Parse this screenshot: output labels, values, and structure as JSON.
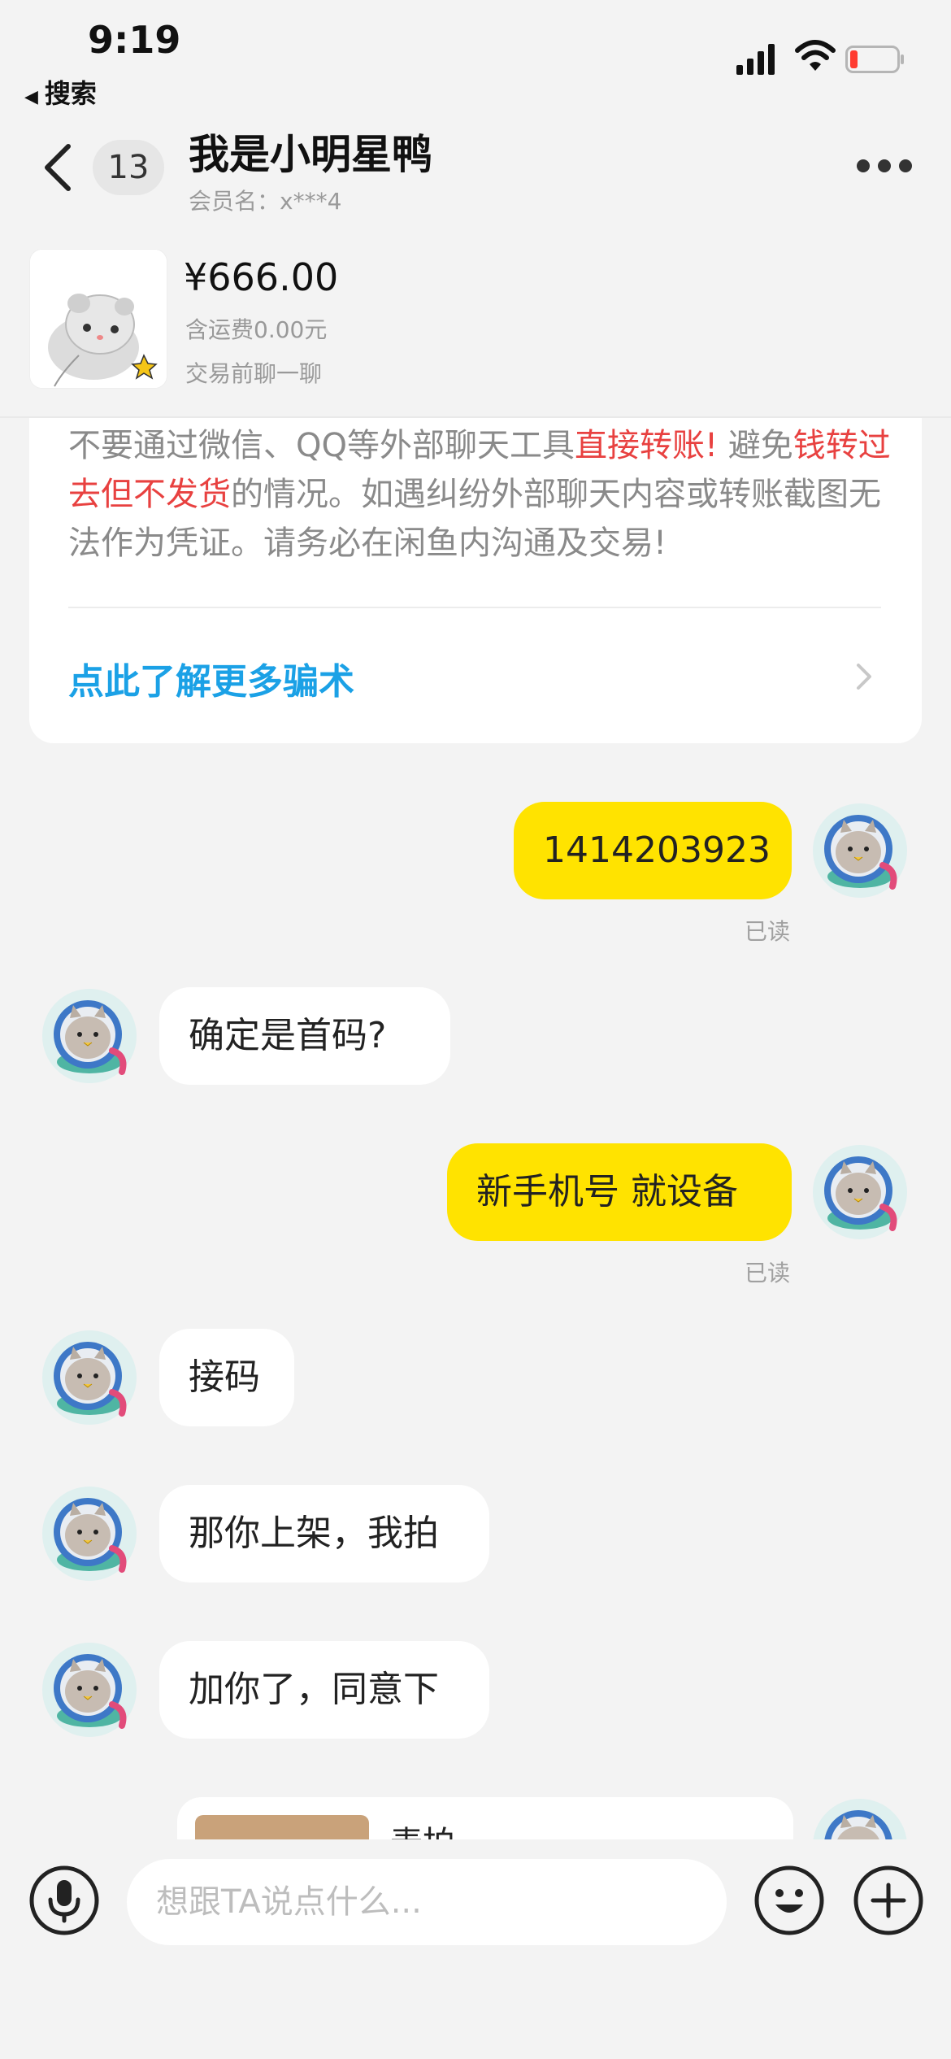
{
  "status_bar": {
    "time": "9:19",
    "back_app": "搜索",
    "icons": [
      "signal-icon",
      "wifi-icon",
      "battery-icon"
    ]
  },
  "header": {
    "unread_count": "13",
    "name": "我是小明星鸭",
    "member_label": "会员名：x***4",
    "icons": [
      "chevron-left-icon",
      "more-icon"
    ]
  },
  "product": {
    "price": "¥666.00",
    "shipping": "含运费0.00元",
    "chat_before": "交易前聊一聊"
  },
  "warning": {
    "seg1": "不要通过微信、QQ等外部聊天工具",
    "seg2": "直接转账!",
    "seg3": " 避免",
    "seg4": "钱转过去但不发货",
    "seg5": "的情况。如遇纠纷外部聊天内容或转账截图无法作为凭证。请务必在闲鱼内沟通及交易!",
    "link": "点此了解更多骗术"
  },
  "messages": [
    {
      "side": "out",
      "text": "1414203923",
      "status": "已读"
    },
    {
      "side": "in",
      "text": "确定是首码?"
    },
    {
      "side": "out",
      "text": "新手机号 就设备",
      "status": "已读"
    },
    {
      "side": "in",
      "text": "接码"
    },
    {
      "side": "in",
      "text": "那你上架，我拍"
    },
    {
      "side": "in",
      "text": "加你了，同意下"
    },
    {
      "side": "out",
      "text": "麦拍"
    }
  ],
  "input": {
    "placeholder": "想跟TA说点什么..."
  },
  "colors": {
    "accent_yellow": "#ffe300",
    "warning_red": "#e84140",
    "link_blue": "#1ba1e6",
    "background": "#f3f3f3"
  }
}
